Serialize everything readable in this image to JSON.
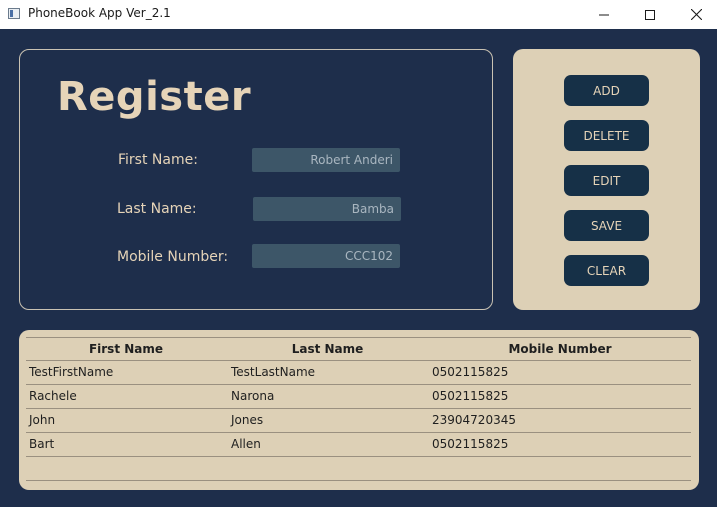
{
  "window": {
    "title": "PhoneBook App Ver_2.1"
  },
  "register": {
    "title": "Register",
    "fields": [
      {
        "label": "First Name:",
        "value": "Robert Anderi"
      },
      {
        "label": "Last Name:",
        "value": "Bamba"
      },
      {
        "label": "Mobile Number:",
        "value": "CCC102"
      }
    ]
  },
  "actions": [
    "ADD",
    "DELETE",
    "EDIT",
    "SAVE",
    "CLEAR"
  ],
  "table": {
    "headers": [
      "First Name",
      "Last Name",
      "Mobile Number"
    ],
    "rows": [
      [
        "TestFirstName",
        "TestLastName",
        "0502115825"
      ],
      [
        "Rachele",
        "Narona",
        "0502115825"
      ],
      [
        "John",
        "Jones",
        "23904720345"
      ],
      [
        "Bart",
        "Allen",
        "0502115825"
      ]
    ]
  },
  "colors": {
    "background": "#1e2e4b",
    "accent_text": "#e6d4b8",
    "panel": "#ddd0b6",
    "button": "#163047",
    "input": "#3d5668"
  }
}
